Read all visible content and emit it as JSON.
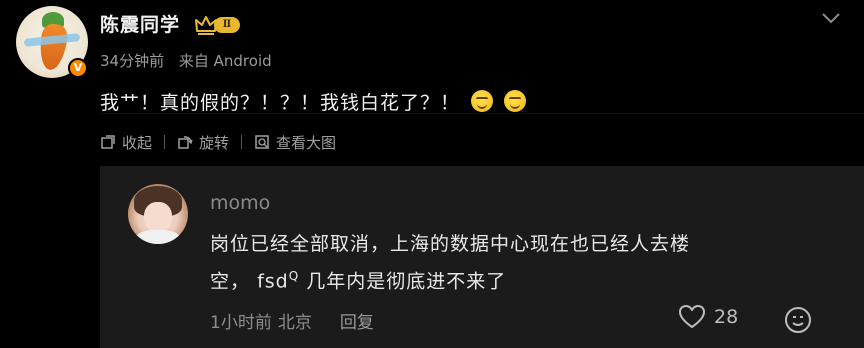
{
  "post": {
    "username": "陈震同学",
    "level_badge": "Ⅱ",
    "verified_mark": "V",
    "meta": {
      "time": "34分钟前",
      "source": "来自 Android"
    },
    "content": "我艹！真的假的？！？！我钱白花了？！",
    "actions": {
      "collapse": "收起",
      "rotate": "旋转",
      "view_large": "查看大图"
    }
  },
  "comment": {
    "name": "momo",
    "text_line1": "岗位已经全部取消，上海的数据中心现在也已经人去楼",
    "text_line2_pre": "空，",
    "text_tag": "fsd",
    "text_sup": "Q",
    "text_line2_post": " 几年内是彻底进不来了",
    "time": "1小时前",
    "location": "北京",
    "reply": "回复",
    "likes": "28"
  },
  "icons": {
    "chevron": "chevron-down-icon",
    "crown": "crown-icon",
    "emoji": "grin-emoji-icon",
    "collapse": "collapse-icon",
    "rotate": "rotate-icon",
    "view_large": "image-search-icon",
    "like": "heart-icon",
    "sticker": "smiley-icon"
  },
  "colors": {
    "background": "#000000",
    "comment_bg": "#1b1b1b",
    "crown_gold": "#e8b930",
    "verified_orange": "#ff8a00"
  }
}
